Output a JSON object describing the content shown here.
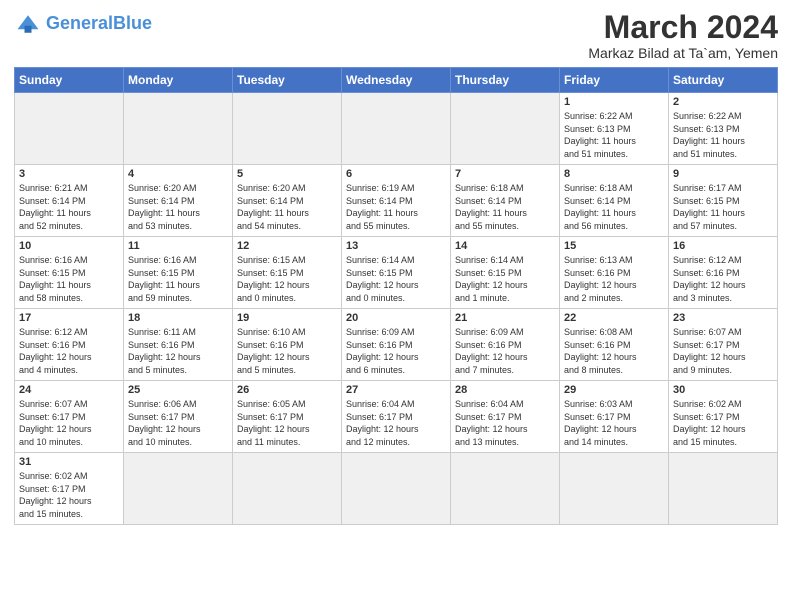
{
  "header": {
    "logo_general": "General",
    "logo_blue": "Blue",
    "month_title": "March 2024",
    "location": "Markaz Bilad at Ta`am, Yemen"
  },
  "weekdays": [
    "Sunday",
    "Monday",
    "Tuesday",
    "Wednesday",
    "Thursday",
    "Friday",
    "Saturday"
  ],
  "weeks": [
    [
      {
        "day": "",
        "info": ""
      },
      {
        "day": "",
        "info": ""
      },
      {
        "day": "",
        "info": ""
      },
      {
        "day": "",
        "info": ""
      },
      {
        "day": "",
        "info": ""
      },
      {
        "day": "1",
        "info": "Sunrise: 6:22 AM\nSunset: 6:13 PM\nDaylight: 11 hours\nand 51 minutes."
      },
      {
        "day": "2",
        "info": "Sunrise: 6:22 AM\nSunset: 6:13 PM\nDaylight: 11 hours\nand 51 minutes."
      }
    ],
    [
      {
        "day": "3",
        "info": "Sunrise: 6:21 AM\nSunset: 6:14 PM\nDaylight: 11 hours\nand 52 minutes."
      },
      {
        "day": "4",
        "info": "Sunrise: 6:20 AM\nSunset: 6:14 PM\nDaylight: 11 hours\nand 53 minutes."
      },
      {
        "day": "5",
        "info": "Sunrise: 6:20 AM\nSunset: 6:14 PM\nDaylight: 11 hours\nand 54 minutes."
      },
      {
        "day": "6",
        "info": "Sunrise: 6:19 AM\nSunset: 6:14 PM\nDaylight: 11 hours\nand 55 minutes."
      },
      {
        "day": "7",
        "info": "Sunrise: 6:18 AM\nSunset: 6:14 PM\nDaylight: 11 hours\nand 55 minutes."
      },
      {
        "day": "8",
        "info": "Sunrise: 6:18 AM\nSunset: 6:14 PM\nDaylight: 11 hours\nand 56 minutes."
      },
      {
        "day": "9",
        "info": "Sunrise: 6:17 AM\nSunset: 6:15 PM\nDaylight: 11 hours\nand 57 minutes."
      }
    ],
    [
      {
        "day": "10",
        "info": "Sunrise: 6:16 AM\nSunset: 6:15 PM\nDaylight: 11 hours\nand 58 minutes."
      },
      {
        "day": "11",
        "info": "Sunrise: 6:16 AM\nSunset: 6:15 PM\nDaylight: 11 hours\nand 59 minutes."
      },
      {
        "day": "12",
        "info": "Sunrise: 6:15 AM\nSunset: 6:15 PM\nDaylight: 12 hours\nand 0 minutes."
      },
      {
        "day": "13",
        "info": "Sunrise: 6:14 AM\nSunset: 6:15 PM\nDaylight: 12 hours\nand 0 minutes."
      },
      {
        "day": "14",
        "info": "Sunrise: 6:14 AM\nSunset: 6:15 PM\nDaylight: 12 hours\nand 1 minute."
      },
      {
        "day": "15",
        "info": "Sunrise: 6:13 AM\nSunset: 6:16 PM\nDaylight: 12 hours\nand 2 minutes."
      },
      {
        "day": "16",
        "info": "Sunrise: 6:12 AM\nSunset: 6:16 PM\nDaylight: 12 hours\nand 3 minutes."
      }
    ],
    [
      {
        "day": "17",
        "info": "Sunrise: 6:12 AM\nSunset: 6:16 PM\nDaylight: 12 hours\nand 4 minutes."
      },
      {
        "day": "18",
        "info": "Sunrise: 6:11 AM\nSunset: 6:16 PM\nDaylight: 12 hours\nand 5 minutes."
      },
      {
        "day": "19",
        "info": "Sunrise: 6:10 AM\nSunset: 6:16 PM\nDaylight: 12 hours\nand 5 minutes."
      },
      {
        "day": "20",
        "info": "Sunrise: 6:09 AM\nSunset: 6:16 PM\nDaylight: 12 hours\nand 6 minutes."
      },
      {
        "day": "21",
        "info": "Sunrise: 6:09 AM\nSunset: 6:16 PM\nDaylight: 12 hours\nand 7 minutes."
      },
      {
        "day": "22",
        "info": "Sunrise: 6:08 AM\nSunset: 6:16 PM\nDaylight: 12 hours\nand 8 minutes."
      },
      {
        "day": "23",
        "info": "Sunrise: 6:07 AM\nSunset: 6:17 PM\nDaylight: 12 hours\nand 9 minutes."
      }
    ],
    [
      {
        "day": "24",
        "info": "Sunrise: 6:07 AM\nSunset: 6:17 PM\nDaylight: 12 hours\nand 10 minutes."
      },
      {
        "day": "25",
        "info": "Sunrise: 6:06 AM\nSunset: 6:17 PM\nDaylight: 12 hours\nand 10 minutes."
      },
      {
        "day": "26",
        "info": "Sunrise: 6:05 AM\nSunset: 6:17 PM\nDaylight: 12 hours\nand 11 minutes."
      },
      {
        "day": "27",
        "info": "Sunrise: 6:04 AM\nSunset: 6:17 PM\nDaylight: 12 hours\nand 12 minutes."
      },
      {
        "day": "28",
        "info": "Sunrise: 6:04 AM\nSunset: 6:17 PM\nDaylight: 12 hours\nand 13 minutes."
      },
      {
        "day": "29",
        "info": "Sunrise: 6:03 AM\nSunset: 6:17 PM\nDaylight: 12 hours\nand 14 minutes."
      },
      {
        "day": "30",
        "info": "Sunrise: 6:02 AM\nSunset: 6:17 PM\nDaylight: 12 hours\nand 15 minutes."
      }
    ],
    [
      {
        "day": "31",
        "info": "Sunrise: 6:02 AM\nSunset: 6:17 PM\nDaylight: 12 hours\nand 15 minutes."
      },
      {
        "day": "",
        "info": ""
      },
      {
        "day": "",
        "info": ""
      },
      {
        "day": "",
        "info": ""
      },
      {
        "day": "",
        "info": ""
      },
      {
        "day": "",
        "info": ""
      },
      {
        "day": "",
        "info": ""
      }
    ]
  ]
}
